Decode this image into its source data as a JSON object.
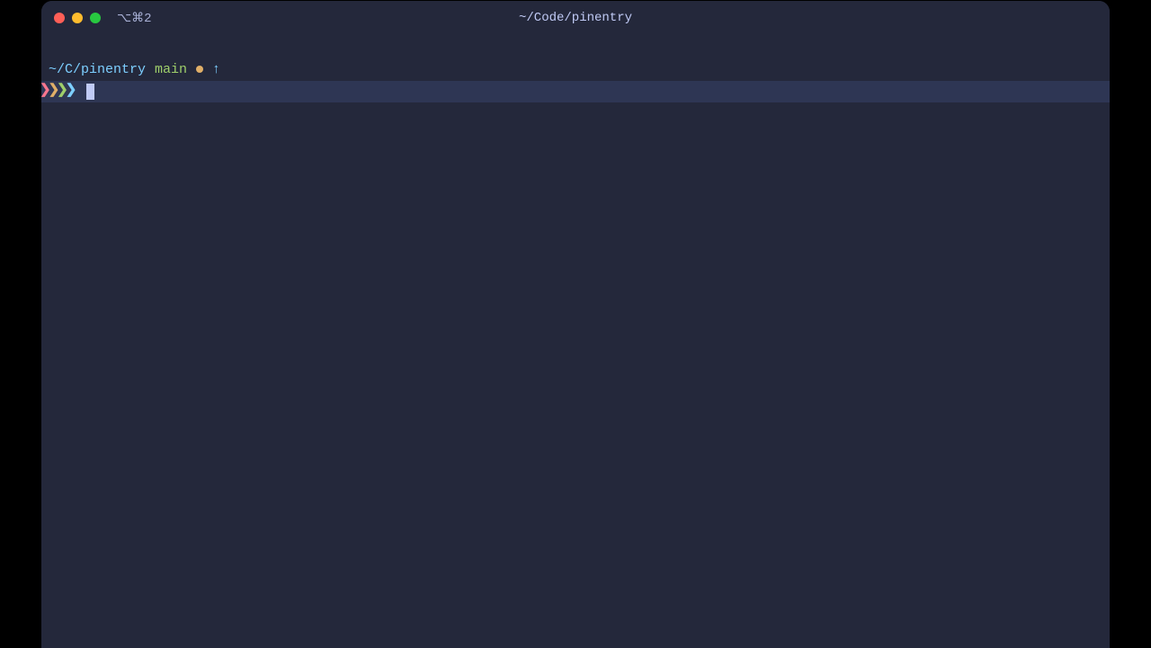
{
  "titlebar": {
    "tab_indicator": "⌥⌘2",
    "title": "~/Code/pinentry"
  },
  "prompt": {
    "cwd": "~/C/pinentry",
    "branch": "main",
    "ahead_symbol": "↑",
    "chevron_glyph": "❯",
    "command_value": ""
  },
  "colors": {
    "bg": "#24283b",
    "prompt_bg": "#2e3654",
    "cyan": "#7dcfff",
    "green": "#9ece6a",
    "yellow": "#e0af68",
    "red": "#f7768e",
    "fg": "#c0caf5"
  }
}
